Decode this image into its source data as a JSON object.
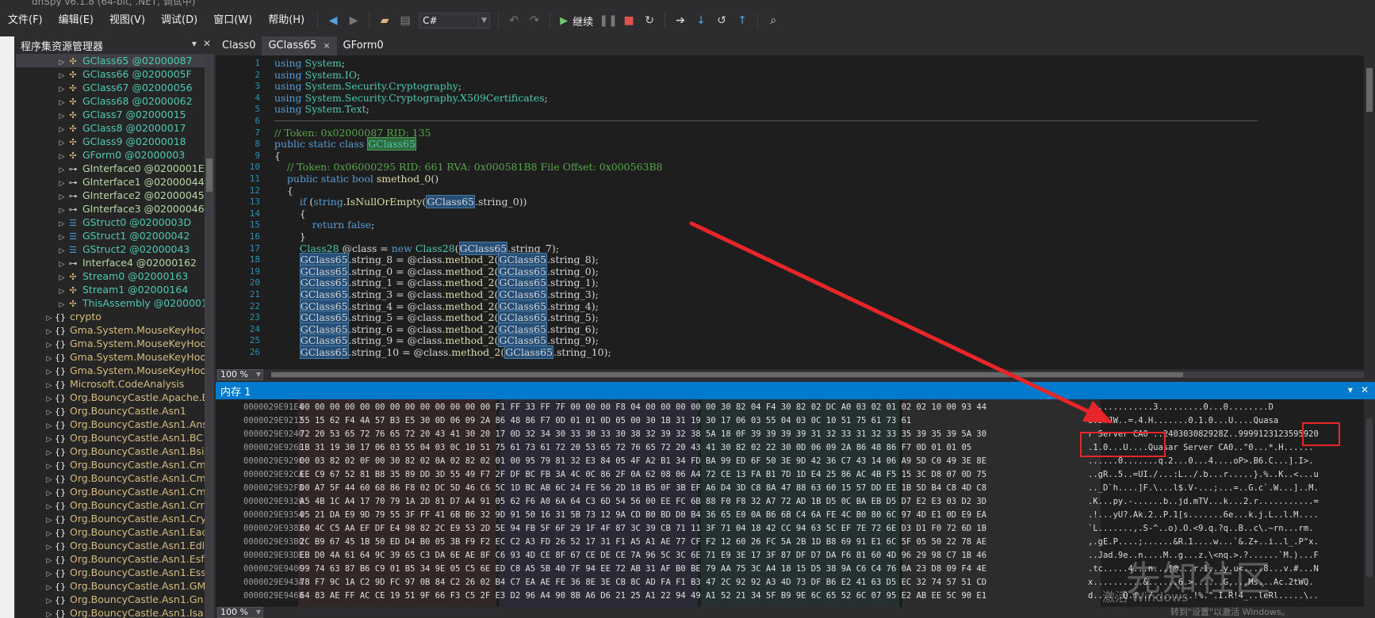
{
  "window": {
    "title": "dnSpy v6.1.8 (64-bit, .NET, 调试中)"
  },
  "menu": [
    {
      "name": "menu-file",
      "label": "文件(F)"
    },
    {
      "name": "menu-edit",
      "label": "编辑(E)"
    },
    {
      "name": "menu-view",
      "label": "视图(V)"
    },
    {
      "name": "menu-debug",
      "label": "调试(D)"
    },
    {
      "name": "menu-window",
      "label": "窗口(W)"
    },
    {
      "name": "menu-help",
      "label": "帮助(H)"
    }
  ],
  "toolbar": {
    "language": "C#",
    "continue_label": "继续"
  },
  "explorer": {
    "title": "程序集资源管理器",
    "items": [
      {
        "indent": 2,
        "kind": "class",
        "label": "GClass65 @02000087",
        "selected": true
      },
      {
        "indent": 2,
        "kind": "class",
        "label": "GClass66 @0200005F"
      },
      {
        "indent": 2,
        "kind": "class",
        "label": "GClass67 @02000056"
      },
      {
        "indent": 2,
        "kind": "class",
        "label": "GClass68 @02000062"
      },
      {
        "indent": 2,
        "kind": "class",
        "label": "GClass7 @02000015"
      },
      {
        "indent": 2,
        "kind": "class",
        "label": "GClass8 @02000017"
      },
      {
        "indent": 2,
        "kind": "class",
        "label": "GClass9 @02000018"
      },
      {
        "indent": 2,
        "kind": "class",
        "label": "GForm0 @02000003"
      },
      {
        "indent": 2,
        "kind": "iface",
        "label": "GInterface0 @0200001E"
      },
      {
        "indent": 2,
        "kind": "iface",
        "label": "GInterface1 @02000044"
      },
      {
        "indent": 2,
        "kind": "iface",
        "label": "GInterface2 @02000045"
      },
      {
        "indent": 2,
        "kind": "iface",
        "label": "GInterface3 @02000046"
      },
      {
        "indent": 2,
        "kind": "struct",
        "label": "GStruct0 @0200003D"
      },
      {
        "indent": 2,
        "kind": "struct",
        "label": "GStruct1 @02000042"
      },
      {
        "indent": 2,
        "kind": "struct",
        "label": "GStruct2 @02000043"
      },
      {
        "indent": 2,
        "kind": "iface",
        "label": "Interface4 @02000162"
      },
      {
        "indent": 2,
        "kind": "class",
        "label": "Stream0 @02000163"
      },
      {
        "indent": 2,
        "kind": "class",
        "label": "Stream1 @02000164"
      },
      {
        "indent": 2,
        "kind": "class",
        "label": "ThisAssembly @0200001"
      },
      {
        "indent": 1,
        "kind": "ns",
        "label": "crypto"
      },
      {
        "indent": 1,
        "kind": "ns",
        "label": "Gma.System.MouseKeyHoo"
      },
      {
        "indent": 1,
        "kind": "ns",
        "label": "Gma.System.MouseKeyHoo"
      },
      {
        "indent": 1,
        "kind": "ns",
        "label": "Gma.System.MouseKeyHoo"
      },
      {
        "indent": 1,
        "kind": "ns",
        "label": "Gma.System.MouseKeyHoo"
      },
      {
        "indent": 1,
        "kind": "ns",
        "label": "Microsoft.CodeAnalysis"
      },
      {
        "indent": 1,
        "kind": "ns",
        "label": "Org.BouncyCastle.Apache.B"
      },
      {
        "indent": 1,
        "kind": "ns",
        "label": "Org.BouncyCastle.Asn1"
      },
      {
        "indent": 1,
        "kind": "ns",
        "label": "Org.BouncyCastle.Asn1.Ans"
      },
      {
        "indent": 1,
        "kind": "ns",
        "label": "Org.BouncyCastle.Asn1.BC"
      },
      {
        "indent": 1,
        "kind": "ns",
        "label": "Org.BouncyCastle.Asn1.Bsi"
      },
      {
        "indent": 1,
        "kind": "ns",
        "label": "Org.BouncyCastle.Asn1.Cm"
      },
      {
        "indent": 1,
        "kind": "ns",
        "label": "Org.BouncyCastle.Asn1.Cm"
      },
      {
        "indent": 1,
        "kind": "ns",
        "label": "Org.BouncyCastle.Asn1.Cm"
      },
      {
        "indent": 1,
        "kind": "ns",
        "label": "Org.BouncyCastle.Asn1.Crr"
      },
      {
        "indent": 1,
        "kind": "ns",
        "label": "Org.BouncyCastle.Asn1.Cry"
      },
      {
        "indent": 1,
        "kind": "ns",
        "label": "Org.BouncyCastle.Asn1.Eac"
      },
      {
        "indent": 1,
        "kind": "ns",
        "label": "Org.BouncyCastle.Asn1.Edl"
      },
      {
        "indent": 1,
        "kind": "ns",
        "label": "Org.BouncyCastle.Asn1.Esf"
      },
      {
        "indent": 1,
        "kind": "ns",
        "label": "Org.BouncyCastle.Asn1.Ess"
      },
      {
        "indent": 1,
        "kind": "ns",
        "label": "Org.BouncyCastle.Asn1.GM"
      },
      {
        "indent": 1,
        "kind": "ns",
        "label": "Org.BouncyCastle.Asn1.Gn"
      },
      {
        "indent": 1,
        "kind": "ns",
        "label": "Org.BouncyCastle.Asn1.Isa"
      }
    ]
  },
  "tabs": [
    {
      "label": "Class0",
      "active": false,
      "close": ""
    },
    {
      "label": "GClass65",
      "active": true,
      "close": "×"
    },
    {
      "label": "GForm0",
      "active": false,
      "close": ""
    }
  ],
  "editor": {
    "zoom": "100 %",
    "lines": [
      [
        [
          "kw",
          "using "
        ],
        [
          "ty",
          "System"
        ],
        [
          "",
          "; "
        ]
      ],
      [
        [
          "kw",
          "using "
        ],
        [
          "ty",
          "System.IO"
        ],
        [
          "",
          ";"
        ]
      ],
      [
        [
          "kw",
          "using "
        ],
        [
          "ty",
          "System.Security.Cryptography"
        ],
        [
          "",
          ";"
        ]
      ],
      [
        [
          "kw",
          "using "
        ],
        [
          "ty",
          "System.Security.Cryptography.X509Certificates"
        ],
        [
          "",
          ";"
        ]
      ],
      [
        [
          "kw",
          "using "
        ],
        [
          "ty",
          "System.Text"
        ],
        [
          "",
          ";"
        ]
      ],
      [],
      [
        [
          "cm",
          "// Token: 0x02000087 RID: 135"
        ]
      ],
      [
        [
          "kw",
          "public static class "
        ],
        [
          "hlg",
          "GClass65"
        ]
      ],
      [
        [
          "",
          "{"
        ]
      ],
      [
        [
          "",
          "    "
        ],
        [
          "cm",
          "// Token: 0x06000295 RID: 661 RVA: 0x000581B8 File Offset: 0x000563B8"
        ]
      ],
      [
        [
          "",
          "    "
        ],
        [
          "kw",
          "public static bool "
        ],
        [
          "mt",
          "smethod_0"
        ],
        [
          "",
          "()"
        ]
      ],
      [
        [
          "",
          "    {"
        ]
      ],
      [
        [
          "",
          "        "
        ],
        [
          "kw",
          "if "
        ],
        [
          "",
          "("
        ],
        [
          "kw",
          "string"
        ],
        [
          "",
          "."
        ],
        [
          "mt",
          "IsNullOrEmpty"
        ],
        [
          "",
          "("
        ],
        [
          "hl",
          "GClass65"
        ],
        [
          "",
          ".string_0))"
        ]
      ],
      [
        [
          "",
          "        {"
        ]
      ],
      [
        [
          "",
          "            "
        ],
        [
          "kw",
          "return false"
        ],
        [
          "",
          ";"
        ]
      ],
      [
        [
          "",
          "        }"
        ]
      ],
      [
        [
          "",
          "        "
        ],
        [
          "ty",
          "Class28 "
        ],
        [
          "",
          "@class = "
        ],
        [
          "kw",
          "new "
        ],
        [
          "ty",
          "Class28"
        ],
        [
          "",
          "("
        ],
        [
          "hl",
          "GClass65"
        ],
        [
          "",
          ".string_7);"
        ]
      ],
      [
        [
          "",
          "        "
        ],
        [
          "hl",
          "GClass65"
        ],
        [
          "",
          ".string_8 = @class."
        ],
        [
          "mt",
          "method_2"
        ],
        [
          "",
          "("
        ],
        [
          "hl",
          "GClass65"
        ],
        [
          "",
          ".string_8);"
        ]
      ],
      [
        [
          "",
          "        "
        ],
        [
          "hl",
          "GClass65"
        ],
        [
          "",
          ".string_0 = @class."
        ],
        [
          "mt",
          "method_2"
        ],
        [
          "",
          "("
        ],
        [
          "hl",
          "GClass65"
        ],
        [
          "",
          ".string_0);"
        ]
      ],
      [
        [
          "",
          "        "
        ],
        [
          "hl",
          "GClass65"
        ],
        [
          "",
          ".string_1 = @class."
        ],
        [
          "mt",
          "method_2"
        ],
        [
          "",
          "("
        ],
        [
          "hl",
          "GClass65"
        ],
        [
          "",
          ".string_1);"
        ]
      ],
      [
        [
          "",
          "        "
        ],
        [
          "hl",
          "GClass65"
        ],
        [
          "",
          ".string_3 = @class."
        ],
        [
          "mt",
          "method_2"
        ],
        [
          "",
          "("
        ],
        [
          "hl",
          "GClass65"
        ],
        [
          "",
          ".string_3);"
        ]
      ],
      [
        [
          "",
          "        "
        ],
        [
          "hl",
          "GClass65"
        ],
        [
          "",
          ".string_4 = @class."
        ],
        [
          "mt",
          "method_2"
        ],
        [
          "",
          "("
        ],
        [
          "hl",
          "GClass65"
        ],
        [
          "",
          ".string_4);"
        ]
      ],
      [
        [
          "",
          "        "
        ],
        [
          "hl",
          "GClass65"
        ],
        [
          "",
          ".string_5 = @class."
        ],
        [
          "mt",
          "method_2"
        ],
        [
          "",
          "("
        ],
        [
          "hl",
          "GClass65"
        ],
        [
          "",
          ".string_5);"
        ]
      ],
      [
        [
          "",
          "        "
        ],
        [
          "hl",
          "GClass65"
        ],
        [
          "",
          ".string_6 = @class."
        ],
        [
          "mt",
          "method_2"
        ],
        [
          "",
          "("
        ],
        [
          "hl",
          "GClass65"
        ],
        [
          "",
          ".string_6);"
        ]
      ],
      [
        [
          "",
          "        "
        ],
        [
          "hl",
          "GClass65"
        ],
        [
          "",
          ".string_9 = @class."
        ],
        [
          "mt",
          "method_2"
        ],
        [
          "",
          "("
        ],
        [
          "hl",
          "GClass65"
        ],
        [
          "",
          ".string_9);"
        ]
      ],
      [
        [
          "",
          "        "
        ],
        [
          "hl",
          "GClass65"
        ],
        [
          "",
          ".string_10 = @class."
        ],
        [
          "mt",
          "method_2"
        ],
        [
          "",
          "("
        ],
        [
          "hl",
          "GClass65"
        ],
        [
          "",
          ".string_10);"
        ]
      ]
    ]
  },
  "memory": {
    "title": "内存 1",
    "zoom": "100 %",
    "rows": [
      {
        "addr": "0000029E91E4",
        "hex": "00 00 00 00 00 00 00 00 00 00 00 00 00 F1 FF 33 FF 7F 00 00 00 F8 04 00 00 00 00 00 30 82 04 F4 30 82 02 DC A0 03 02 01 02 02 10 00 93 44",
        "ascii": ".............3.........0...0........D"
      },
      {
        "addr": "0000029E9212",
        "hex": "55 15 62 F4 4A 57 B3 E5 30 0D 06 09 2A 86 48 86 F7 0D 01 01 0D 05 00 30 1B 31 19 30 17 06 03 55 04 03 0C 10 51 75 61 73 61",
        "ascii": "U.b.JW..=.4.H.......0.1.0...U....Quasa"
      },
      {
        "addr": "0000029E9240",
        "hex": "72 20 53 65 72 76 65 72 20 43 41 30 20 17 0D 32 34 30 33 30 33 30 38 32 39 32 38 5A 18 0F 39 39 39 39 31 32 33 31 32 33 35 39 35 39 5A 30",
        "ascii": "r Server CA0 ..240303082928Z..9999123123595920"
      },
      {
        "addr": "0000029E926E",
        "hex": "1B 31 19 30 17 06 03 55 04 03 0C 10 51 75 61 73 61 72 20 53 65 72 76 65 72 20 43 41 30 82 02 22 30 0D 06 09 2A 86 48 86 F7 0D 01 01 05",
        "ascii": ".1.0...U....Quasar Server CA0..\"0...*.H......"
      },
      {
        "addr": "0000029E929C",
        "hex": "00 03 82 02 0F 00 30 82 02 0A 02 82 02 01 00 95 79 81 32 E3 84 05 4F A2 B1 34 FD BA 99 ED 6F 50 3E 9D 42 36 C7 43 14 06 A9 5D C0 49 3E 8E",
        "ascii": "......0.......q.2...0...4....oP>.B6.C...].I>."
      },
      {
        "addr": "0000029E92CA",
        "hex": "EE C9 67 52 81 B8 35 89 DD 3D 55 49 F7 2F DF BC FB 3A 4C 0C 86 2F 0A 62 08 06 A4 72 CE 13 FA B1 7D 1D E4 25 86 AC 4B F5 15 3C D8 07 0D 75",
        "ascii": "..gR..5..=UI./...:L../.b...r.....}.%..K..<...u"
      },
      {
        "addr": "0000029E92F8",
        "hex": "D0 A7 5F 44 60 68 86 F8 02 DC 5D 46 C6 5C 1D BC AB 6C 24 FE 56 2D 18 B5 0F 3B EF A6 D4 3D C8 8A 47 88 63 60 15 57 DD EE 1B 5D B4 C8 4D C8",
        "ascii": ".._D`h....]F.\\...l$.V-...;...=..G.c`.W...]..M."
      },
      {
        "addr": "0000029E9326",
        "hex": "A5 4B 1C A4 17 70 79 1A 2D 81 D7 A4 91 05 62 F6 A0 6A 64 C3 6D 54 56 00 EE FC 6B 88 F0 F8 32 A7 72 AD 1B D5 0C BA EB D5 D7 E2 E3 03 D2 3D",
        "ascii": ".K...py.-......b..jd.mTV...k...2.r...........="
      },
      {
        "addr": "0000029E9354",
        "hex": "05 21 DA E9 9D 79 55 3F FF 41 6B B6 32 9D 91 50 16 31 5B 73 12 9A CD B0 BD D0 B4 36 65 E0 0A B6 6B C4 6A FE 4C B0 80 6C 97 4D E1 0D E9 EA",
        "ascii": ".!...yU?.Ak.2..P.1[s.......6e...k.j.L..l.M...."
      },
      {
        "addr": "0000029E9382",
        "hex": "60 4C C5 AA EF DF E4 98 82 2C E9 53 2D 5E 94 FB 5F 6F 29 1F 4F 87 3C 39 CB 71 11 3F 71 04 18 42 CC 94 63 5C EF 7E 72 6E D3 D1 F0 72 6D 1B",
        "ascii": "`L.......,.S-^..o).O.<9.q.?q..B..c\\.~rn...rm."
      },
      {
        "addr": "0000029E93B0",
        "hex": "2C B9 67 45 1B 50 ED D4 B0 05 3B F9 F2 EC C2 A3 FD 26 52 17 31 F1 A5 A1 AE 77 CF F2 12 60 26 FC 5A 2B 1D B8 69 91 E1 6C 5F 05 50 22 78 AE",
        "ascii": ",.gE.P....;......&R.1....w...`&.Z+..i..l_.P\"x."
      },
      {
        "addr": "0000029E93DE",
        "hex": "EB D0 4A 61 64 9C 39 65 C3 DA 6E AE 8F C6 93 4D CE 8F 67 CE DE CE 7A 96 5C 3C 6E 71 E9 3E 17 3F 87 DF D7 DA F6 81 60 4D 96 29 98 C7 1B 46",
        "ascii": "..Jad.9e..n....M..g...z.\\<nq.>.?......`M.)...F"
      },
      {
        "addr": "0000029E940C",
        "hex": "99 74 63 87 B6 C9 01 B5 34 9E 05 C5 6E ED C8 A5 5B 40 7F 94 EE 72 AB 31 AF B0 BE 79 AA 75 3C A4 18 15 D5 38 9A C6 C4 76 0A 23 D8 09 F4 4E",
        "ascii": ".tc.....4...n...[@...r.1...y.u<....8...v.#...N"
      },
      {
        "addr": "0000029E943A",
        "hex": "78 F7 9C 1A C2 9D FC 97 0B 84 C2 26 02 B4 C7 EA AE FE 36 8E 3E CB 8C AD FA F1 B3 47 2C 92 92 A3 4D 73 DF B6 E2 41 63 D5 EC 32 74 57 51 CD",
        "ascii": "x..........&......6.>......G,...Ms...Ac.2tWQ."
      },
      {
        "addr": "0000029E9468",
        "hex": "64 83 AE FF AC CE 19 51 9F 66 F3 C5 2F E3 D2 96 A4 90 8B A6 D6 21 25 A1 22 94 49 A1 52 21 34 5F B9 9E 6C 65 52 6C 07 95 E2 AB EE 5C 90 E1",
        "ascii": "d......Q.f../........!%.\".I.R!4_..leRl.....\\.."
      }
    ]
  },
  "watermark": {
    "logo": "先知社区",
    "line1": "激活 Windows",
    "line2": "转到\"设置\"以激活 Windows。"
  },
  "colors": {
    "accent": "#007acc",
    "annotation": "#e8262a",
    "namespace": "#d7ba7d",
    "class": "#4ec9b0",
    "keyword": "#569cd6"
  }
}
